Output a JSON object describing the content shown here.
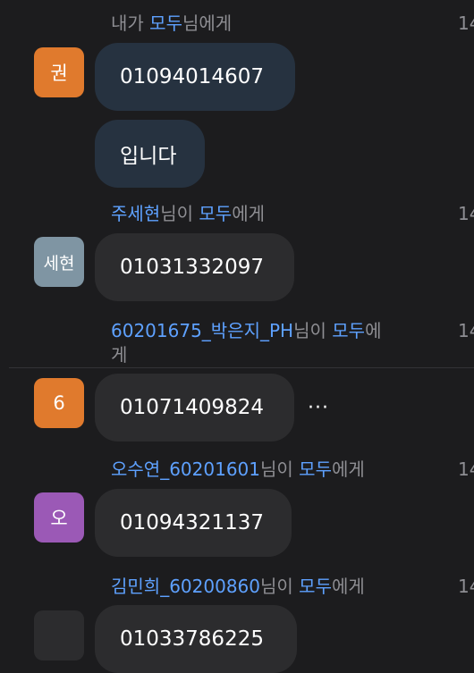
{
  "messages": [
    {
      "sender_line": [
        "내가 ",
        "모두",
        "님에게"
      ],
      "time": "14",
      "avatar": {
        "text": "권",
        "color": "#e07a2d"
      },
      "bubbles": [
        "01094014607",
        "입니다"
      ]
    },
    {
      "sender_line": [
        "주세현",
        "님이 ",
        "모두",
        "에게"
      ],
      "time": "14",
      "avatar": {
        "text": "세현",
        "color": "#7f95a3"
      },
      "bubbles": [
        "01031332097"
      ]
    },
    {
      "sender_line": [
        "60201675_박은지_PH",
        "님이 ",
        "모두",
        "에"
      ],
      "sender_line_wrap": "게",
      "time": "14",
      "avatar": {
        "text": "6",
        "color": "#e07a2d"
      },
      "bubbles": [
        "01071409824"
      ],
      "more_label": "···"
    },
    {
      "sender_line": [
        "오수연_60201601",
        "님이 ",
        "모두",
        "에게"
      ],
      "time": "14",
      "avatar": {
        "text": "오",
        "color": "#9b59b6"
      },
      "bubbles": [
        "01094321137"
      ]
    },
    {
      "sender_line": [
        "김민희_60200860",
        "님이 ",
        "모두",
        "에게"
      ],
      "time": "14",
      "avatar": {
        "text": "",
        "color": "#2c2c2e"
      },
      "bubbles": [
        "01033786225"
      ]
    }
  ]
}
